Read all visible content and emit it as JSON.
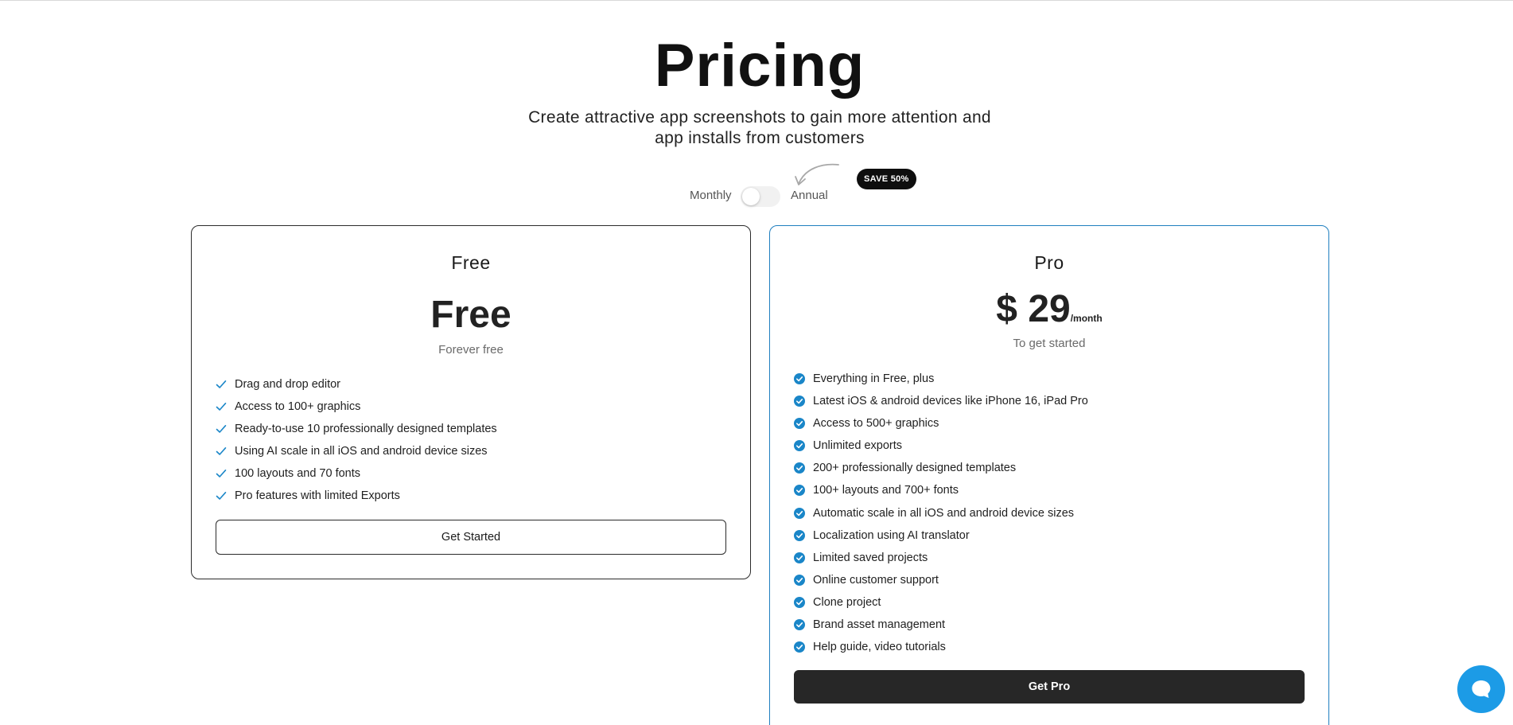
{
  "hero": {
    "title": "Pricing",
    "subtitle": "Create attractive app screenshots to gain more attention and app installs from customers"
  },
  "billing": {
    "monthly_label": "Monthly",
    "annual_label": "Annual",
    "save_badge": "SAVE 50%",
    "toggle_state": "monthly"
  },
  "plans": [
    {
      "name": "Free",
      "price": "Free",
      "period": "",
      "note": "Forever free",
      "features": [
        "Drag and drop editor",
        "Access to 100+ graphics",
        "Ready-to-use 10 professionally designed templates",
        "Using AI scale in all iOS and android device sizes",
        "100 layouts and 70 fonts",
        "Pro features with limited Exports"
      ],
      "cta": "Get Started"
    },
    {
      "name": "Pro",
      "price": "$ 29",
      "period": "/month",
      "note": "To get started",
      "features": [
        "Everything in Free, plus",
        "Latest iOS & android devices like iPhone 16, iPad Pro",
        "Access to 500+ graphics",
        "Unlimited exports",
        "200+ professionally designed templates",
        "100+ layouts and 700+ fonts",
        "Automatic scale in all iOS and android device sizes",
        "Localization using AI translator",
        "Limited saved projects",
        "Online customer support",
        "Clone project",
        "Brand asset management",
        "Help guide, video tutorials"
      ],
      "cta": "Get Pro"
    }
  ],
  "colors": {
    "accent_blue": "#1f7fbf",
    "check_blue": "#1a86c8",
    "chat_blue": "#1c9be6",
    "dark": "#272727"
  },
  "icons": {
    "free_feature": "check-icon",
    "pro_feature": "check-circle-icon",
    "chat": "chat-bubble-icon",
    "arrow": "curved-arrow-icon"
  }
}
